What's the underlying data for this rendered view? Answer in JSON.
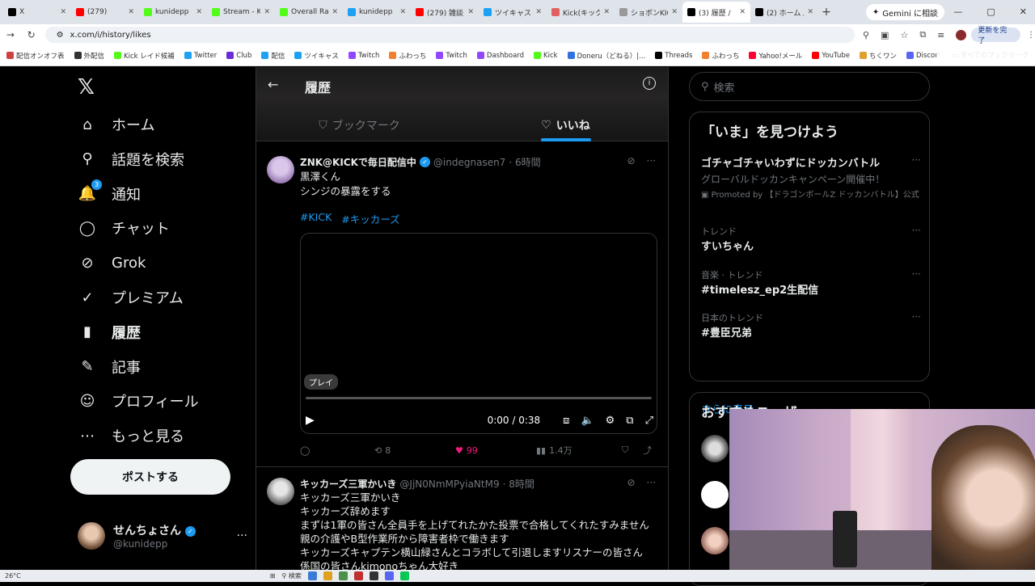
{
  "browser": {
    "tabs": [
      {
        "title": "X",
        "color": "#000000"
      },
      {
        "title": "(279)",
        "color": "#ff0000"
      },
      {
        "title": "kunidepp",
        "color": "#53fc18"
      },
      {
        "title": "Stream - K",
        "color": "#53fc18"
      },
      {
        "title": "Overall Ra",
        "color": "#53fc18"
      },
      {
        "title": "kunidepp",
        "color": "#1da1f2"
      },
      {
        "title": "(279) 雑談",
        "color": "#ff0000"
      },
      {
        "title": "ツイキャス",
        "color": "#1da1f2"
      },
      {
        "title": "Kick(キック",
        "color": "#e06060"
      },
      {
        "title": "ショボンKIC",
        "color": "#999999"
      },
      {
        "title": "(3) 履歴 /",
        "color": "#000000",
        "active": true
      },
      {
        "title": "(2) ホーム /",
        "color": "#000000"
      }
    ],
    "gemini_label": "Gemini に相談",
    "url": "x.com/i/history/likes",
    "update_label": "更新を完了",
    "bookmarks": [
      {
        "label": "配信オンオフ表",
        "color": "#d04040"
      },
      {
        "label": "外配信",
        "color": "#333333"
      },
      {
        "label": "Kick レイド候補",
        "color": "#53fc18"
      },
      {
        "label": "Twitter",
        "color": "#1da1f2"
      },
      {
        "label": "Club",
        "color": "#6a2bd8"
      },
      {
        "label": "配信",
        "color": "#1da1f2"
      },
      {
        "label": "ツイキャス",
        "color": "#1da1f2"
      },
      {
        "label": "Twitch",
        "color": "#9146ff"
      },
      {
        "label": "ふわっち",
        "color": "#f08030"
      },
      {
        "label": "Twitch",
        "color": "#9146ff"
      },
      {
        "label": "Dashboard",
        "color": "#9146ff"
      },
      {
        "label": "Kick",
        "color": "#53fc18"
      },
      {
        "label": "Doneru（どねる）|...",
        "color": "#3070e0"
      },
      {
        "label": "Threads",
        "color": "#000000"
      },
      {
        "label": "ふわっち",
        "color": "#f08030"
      },
      {
        "label": "Yahoo!メール",
        "color": "#ff0033"
      },
      {
        "label": "YouTube",
        "color": "#ff0000"
      },
      {
        "label": "ちくワン",
        "color": "#e0a030"
      },
      {
        "label": "Discord StreamKit O...",
        "color": "#5865f2"
      }
    ],
    "all_bookmarks": "すべてのブックマーク"
  },
  "nav": {
    "items": [
      {
        "label": "ホーム",
        "icon": "home-icon",
        "glyph": "⌂"
      },
      {
        "label": "話題を検索",
        "icon": "search-icon",
        "glyph": "⚲"
      },
      {
        "label": "通知",
        "icon": "bell-icon",
        "glyph": "🔔",
        "badge": "3"
      },
      {
        "label": "チャット",
        "icon": "chat-icon",
        "glyph": "◯"
      },
      {
        "label": "Grok",
        "icon": "grok-icon",
        "glyph": "⊘"
      },
      {
        "label": "プレミアム",
        "icon": "premium-icon",
        "glyph": "✓"
      },
      {
        "label": "履歴",
        "icon": "bookmark-icon",
        "glyph": "▮",
        "active": true
      },
      {
        "label": "記事",
        "icon": "article-icon",
        "glyph": "✎"
      },
      {
        "label": "プロフィール",
        "icon": "profile-icon",
        "glyph": "☺"
      },
      {
        "label": "もっと見る",
        "icon": "more-icon",
        "glyph": "⋯"
      }
    ],
    "post_label": "ポストする",
    "me": {
      "name": "せんちょさん",
      "handle": "@kunidepp"
    }
  },
  "feed": {
    "title": "履歴",
    "tabs": [
      {
        "label": "ブックマーク",
        "icon": "bookmark-icon"
      },
      {
        "label": "いいね",
        "icon": "heart-icon",
        "active": true
      }
    ],
    "posts": [
      {
        "name": "ZNK@KICKで毎日配信中",
        "handle": "@indegnasen7",
        "time": "· 6時間",
        "lines": [
          "黒澤くん",
          "シンジの暴露をする"
        ],
        "tags": [
          "#KICK",
          "#キッカーズ"
        ],
        "video": {
          "tooltip": "プレイ",
          "time": "0:00 / 0:38"
        },
        "actions": {
          "replies": "",
          "reposts": "8",
          "likes": "99",
          "views": "1.4万"
        }
      },
      {
        "name": "キッカーズ三軍かいき",
        "handle": "@JjN0NmMPyiaNtM9",
        "time": "· 8時間",
        "lines": [
          "キッカーズ三軍かいき",
          "キッカーズ辞めます",
          "まずは1軍の皆さん全員手を上げてれたかた投票で合格してくれたすみません",
          "親の介護やB型作業所から障害者枠で働きます",
          "キッカーズキャプテン横山緑さんとコラボして引退しますリスナーの皆さん",
          "係国の皆さんkimonoちゃん大好き"
        ]
      }
    ]
  },
  "sidebar": {
    "search_placeholder": "検索",
    "trend_title": "「いま」を見つけよう",
    "trends": [
      {
        "title": "ゴチャゴチャいわずにドッカンバトル",
        "sub": "グローバルドッカンキャンペーン開催中！",
        "promo": "Promoted by 【ドラゴンボールZ ドッカンバトル】公式"
      },
      {
        "category": "トレンド",
        "title": "すいちゃん"
      },
      {
        "category": "音楽 · トレンド",
        "title": "#timelesz_ep2生配信"
      },
      {
        "category": "日本のトレンド",
        "title": "#豊臣兄弟"
      }
    ],
    "show_more": "さらに表示",
    "recs_title": "おすすめユーザー"
  },
  "taskbar": {
    "weather": "26°C",
    "search": "検索"
  }
}
